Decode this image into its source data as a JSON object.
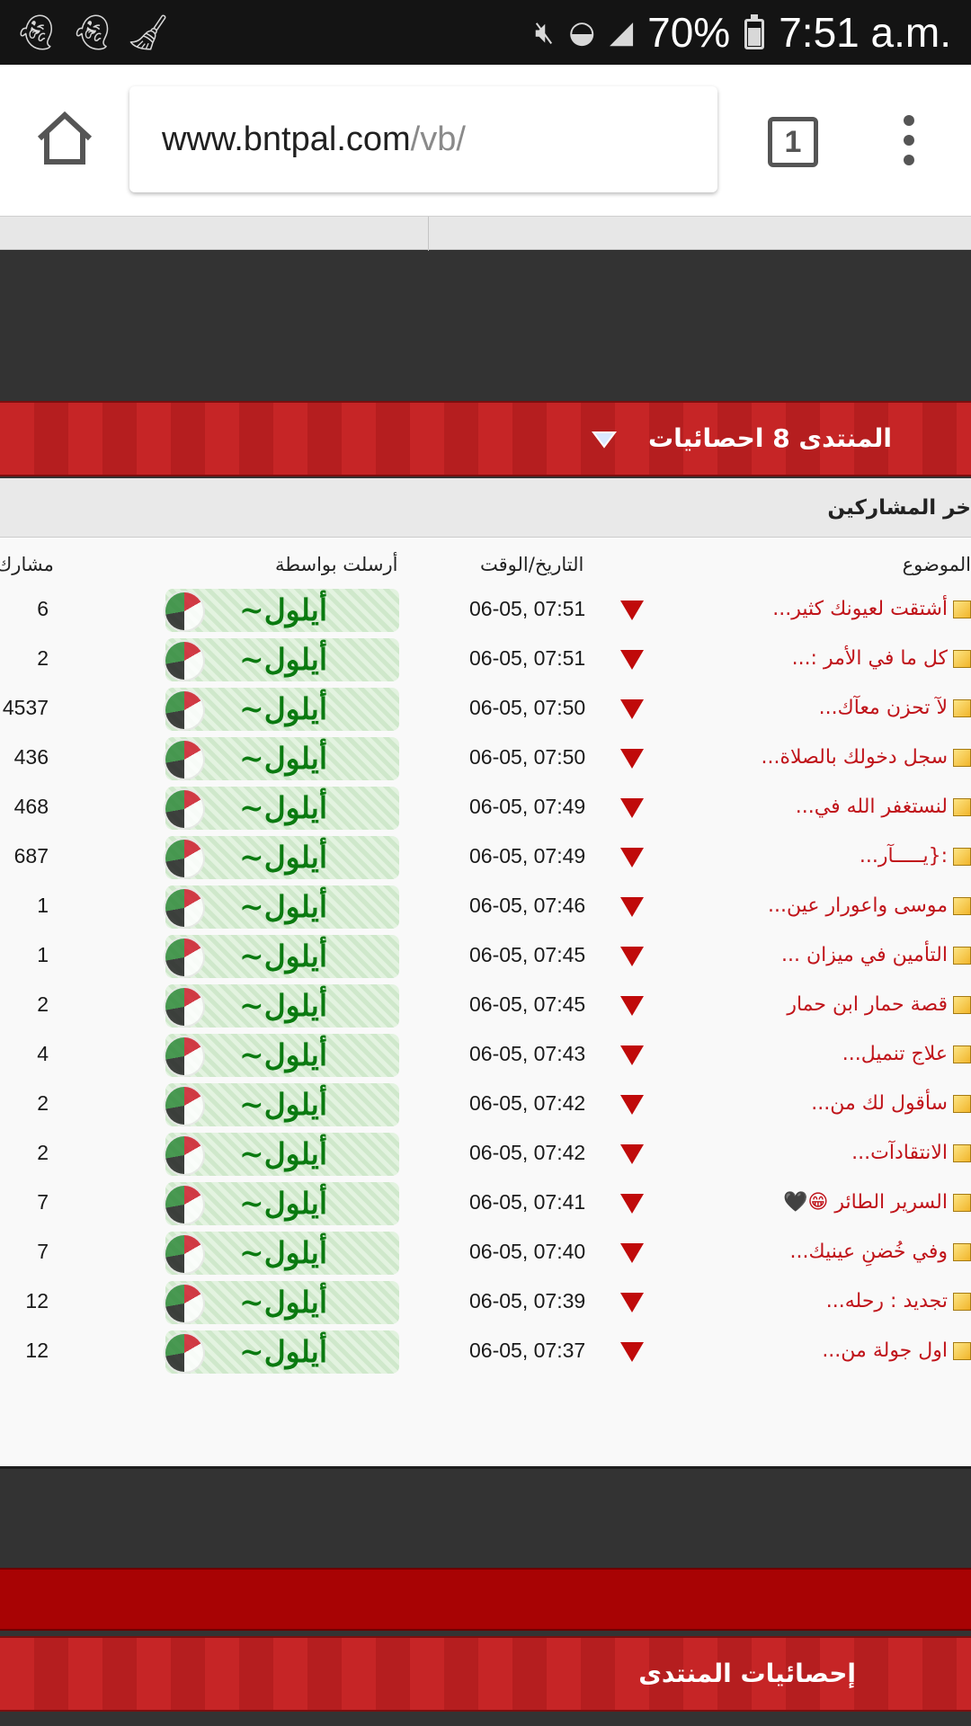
{
  "status_bar": {
    "battery": "70%",
    "time": "7:51 a.m.",
    "left_icons": [
      "snapchat-ghost-icon",
      "snapchat-ghost-icon",
      "broom-icon"
    ],
    "right_icons": [
      "mute-icon",
      "wifi-icon",
      "signal-icon",
      "battery-icon"
    ]
  },
  "browser": {
    "url_domain": "www.bntpal.com",
    "url_path": "/vb/",
    "tab_count": "1"
  },
  "stats_section": {
    "title": "المنتدى 8 احصائيات",
    "subheader": "خر المشاركين",
    "columns": {
      "topic": "الموضوع",
      "datetime": "التاريخ/الوقت",
      "posted_by": "أرسلت بواسطة",
      "count": "مشارك"
    },
    "rows": [
      {
        "topic": "أشتقت لعيونك كثير...",
        "datetime": "06-05, 07:51",
        "user": "أيلول~",
        "count": "6"
      },
      {
        "topic": "كل ما في الأمر :...",
        "datetime": "06-05, 07:51",
        "user": "أيلول~",
        "count": "2"
      },
      {
        "topic": "لآ تحزن معآك...",
        "datetime": "06-05, 07:50",
        "user": "أيلول~",
        "count": "4537"
      },
      {
        "topic": "سجل دخولك بالصلاة...",
        "datetime": "06-05, 07:50",
        "user": "أيلول~",
        "count": "436"
      },
      {
        "topic": "لنستغفر الله في...",
        "datetime": "06-05, 07:49",
        "user": "أيلول~",
        "count": "468"
      },
      {
        "topic": ":{يـــــآر...",
        "datetime": "06-05, 07:49",
        "user": "أيلول~",
        "count": "687"
      },
      {
        "topic": "موسى واعورار عين...",
        "datetime": "06-05, 07:46",
        "user": "أيلول~",
        "count": "1"
      },
      {
        "topic": "التأمين في ميزان ...",
        "datetime": "06-05, 07:45",
        "user": "أيلول~",
        "count": "1"
      },
      {
        "topic": "قصة حمار ابن حمار",
        "datetime": "06-05, 07:45",
        "user": "أيلول~",
        "count": "2"
      },
      {
        "topic": "علاج تنميل...",
        "datetime": "06-05, 07:43",
        "user": "أيلول~",
        "count": "4"
      },
      {
        "topic": "سأقول لك من...",
        "datetime": "06-05, 07:42",
        "user": "أيلول~",
        "count": "2"
      },
      {
        "topic": "الانتقادآت...",
        "datetime": "06-05, 07:42",
        "user": "أيلول~",
        "count": "2"
      },
      {
        "topic": "السرير الطائر 😁🖤",
        "datetime": "06-05, 07:41",
        "user": "أيلول~",
        "count": "7"
      },
      {
        "topic": "وفي خُضنِ عينيك...",
        "datetime": "06-05, 07:40",
        "user": "أيلول~",
        "count": "7"
      },
      {
        "topic": "تجديد : رحله...",
        "datetime": "06-05, 07:39",
        "user": "أيلول~",
        "count": "12"
      },
      {
        "topic": "اول جولة من...",
        "datetime": "06-05, 07:37",
        "user": "أيلول~",
        "count": "12"
      }
    ]
  },
  "footer_section": {
    "title": "إحصائيات المنتدى"
  },
  "colors": {
    "header_red": "#c62526",
    "link_red": "#c0141a",
    "user_green": "#0a7a10",
    "page_bg": "#333333"
  }
}
